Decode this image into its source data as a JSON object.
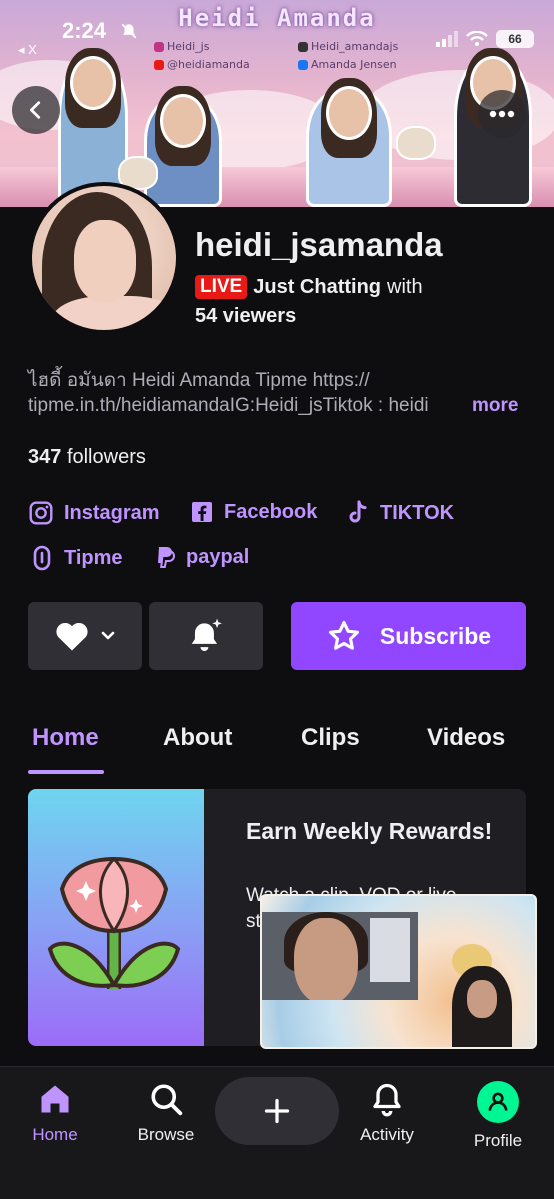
{
  "status_bar": {
    "time": "2:24",
    "back_label": "◂ X",
    "battery": "66"
  },
  "banner": {
    "title": "Heidi Amanda",
    "tags": {
      "instagram": "Heidi_js",
      "youtube": "@heidiamanda",
      "tiktok": "Heidi_amandajs",
      "facebook": "Amanda Jensen"
    }
  },
  "profile": {
    "username": "heidi_jsamanda",
    "live_badge": "LIVE",
    "category": "Just Chatting",
    "with_text": "with",
    "viewers": "54 viewers",
    "bio_line1": "ไฮดี้ อมันดา Heidi Amanda Tipme https://",
    "bio_line2": "tipme.in.th/heidiamandaIG:Heidi_jsTiktok : heidi",
    "bio_more": "more",
    "followers_count": "347",
    "followers_label": "followers"
  },
  "links": [
    {
      "label": "Instagram",
      "icon": "instagram-icon"
    },
    {
      "label": "Facebook",
      "icon": "facebook-icon"
    },
    {
      "label": "TIKTOK",
      "icon": "tiktok-icon"
    },
    {
      "label": "Tipme",
      "icon": "tipme-icon"
    },
    {
      "label": "paypal",
      "icon": "paypal-icon"
    }
  ],
  "actions": {
    "subscribe_label": "Subscribe"
  },
  "tabs": [
    {
      "label": "Home",
      "active": true
    },
    {
      "label": "About",
      "active": false
    },
    {
      "label": "Clips",
      "active": false
    },
    {
      "label": "Videos",
      "active": false
    }
  ],
  "rewards_card": {
    "title": "Earn Weekly Rewards!",
    "description": "Watch a clip, VOD or live stream to earn"
  },
  "nav": {
    "home": "Home",
    "browse": "Browse",
    "activity": "Activity",
    "profile": "Profile"
  },
  "colors": {
    "accent": "#bf94ff",
    "brand_purple": "#9147ff",
    "live_red": "#e91916",
    "background": "#0e0e10",
    "button_dark": "#2f2f35"
  }
}
